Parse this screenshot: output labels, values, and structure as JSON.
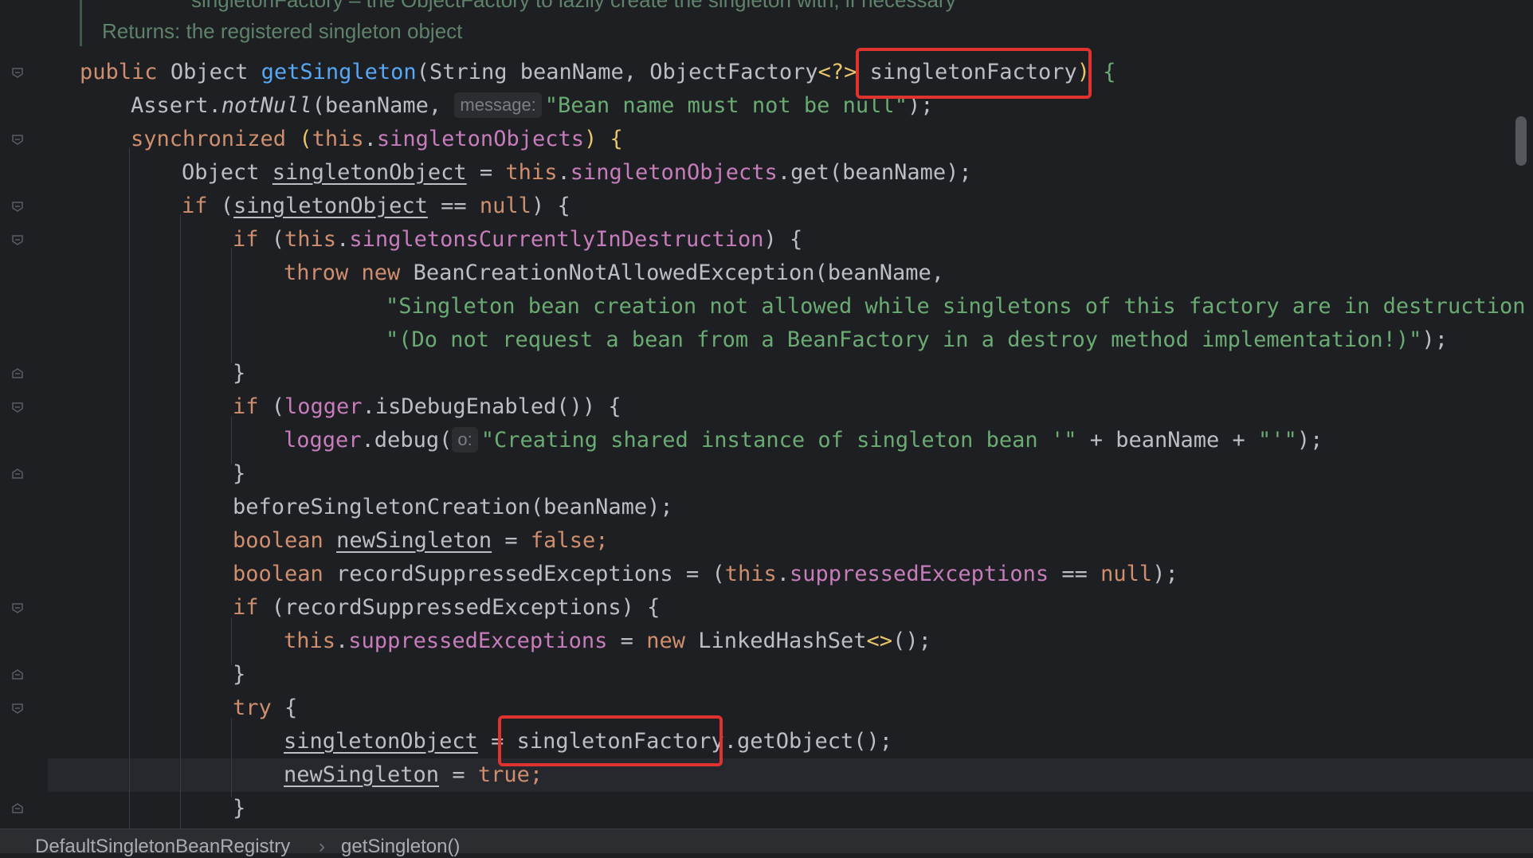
{
  "editor": {
    "doc": {
      "cut_line": "singletonFactory – the ObjectFactory to lazily create the singleton with, if necessary",
      "returns_line": "Returns: the registered singleton object"
    },
    "code": {
      "l1": {
        "kw": "public",
        "type": "Object",
        "fn": "getSingleton",
        "p1": "(String beanName, ObjectFactory",
        "gen": "<?>",
        "sp": " ",
        "param": "singletonFactory",
        "close": ")",
        "brace": " {"
      },
      "l2": {
        "a": "Assert.",
        "fn": "notNull",
        "b": "(beanName, ",
        "hint": "message:",
        "str": "\"Bean name must not be null\"",
        "end": ");"
      },
      "l3": {
        "kw": "synchronized",
        "a": " (",
        "this": "this",
        "dot": ".",
        "fld": "singletonObjects",
        "end": ") {"
      },
      "l4": {
        "type": "Object ",
        "var": "singletonObject",
        "eq": " = ",
        "this": "this",
        "dot": ".",
        "fld": "singletonObjects",
        "get": ".get(beanName);"
      },
      "l5": {
        "kw": "if",
        "a": " (",
        "var": "singletonObject",
        "op": " == ",
        "nul": "null",
        "end": ") {"
      },
      "l6": {
        "kw": "if",
        "a": " (",
        "this": "this",
        "dot": ".",
        "fld": "singletonsCurrentlyInDestruction",
        "end": ") {"
      },
      "l7": {
        "kw1": "throw",
        "kw2": "new",
        "type": " BeanCreationNotAllowedException",
        "end": "(beanName,"
      },
      "l8": {
        "str": "\"Singleton bean creation not allowed while singletons of this factory are in destruction \" +"
      },
      "l9": {
        "str": "\"(Do not request a bean from a BeanFactory in a destroy method implementation!)\"",
        "end": ");"
      },
      "l10": {
        "end": "}"
      },
      "l11": {
        "kw": "if",
        "a": " (",
        "fld": "logger",
        "b": ".isDebugEnabled()) {"
      },
      "l12": {
        "fld": "logger",
        "a": ".debug(",
        "hint": "o:",
        "str": "\"Creating shared instance of singleton bean '\"",
        "b": " + beanName + ",
        "str2": "\"'\"",
        "end": ");"
      },
      "l13": {
        "end": "}"
      },
      "l14": {
        "a": "beforeSingletonCreation(beanName);"
      },
      "l15": {
        "kw": "boolean",
        "sp": " ",
        "var": "newSingleton",
        "eq": " = ",
        "val": "false",
        "end": ";"
      },
      "l16": {
        "kw": "boolean",
        "a": " recordSuppressedExceptions = (",
        "this": "this",
        "dot": ".",
        "fld": "suppressedExceptions",
        "op": " == ",
        "nul": "null",
        "end": ");"
      },
      "l17": {
        "kw": "if",
        "a": " (recordSuppressedExceptions) {"
      },
      "l18": {
        "this": "this",
        "dot": ".",
        "fld": "suppressedExceptions",
        "eq": " = ",
        "kw": "new",
        "type": " LinkedHashSet",
        "gen": "<>",
        "end": "();"
      },
      "l19": {
        "end": "}"
      },
      "l20": {
        "kw": "try",
        "end": " {"
      },
      "l21": {
        "var": "singletonObject",
        "eq": " = ",
        "param": "singletonFactory",
        "end": ".getObject();"
      },
      "l22": {
        "var": "newSingleton",
        "eq": " = ",
        "val": "true",
        "end": ";"
      },
      "l23": {
        "end": "}"
      }
    }
  },
  "status_bar": {
    "crumb1": "DefaultSingletonBeanRegistry",
    "separator": "›",
    "crumb2": "getSingleton()"
  },
  "icons": [
    "fold-marker-icon",
    "breadcrumb-separator-icon"
  ],
  "colors": {
    "background": "#1e1f22",
    "keyword": "#cf8e6d",
    "method": "#56a8f5",
    "field": "#c77dbb",
    "string": "#6aab73",
    "highlight_box": "#e0322f"
  }
}
